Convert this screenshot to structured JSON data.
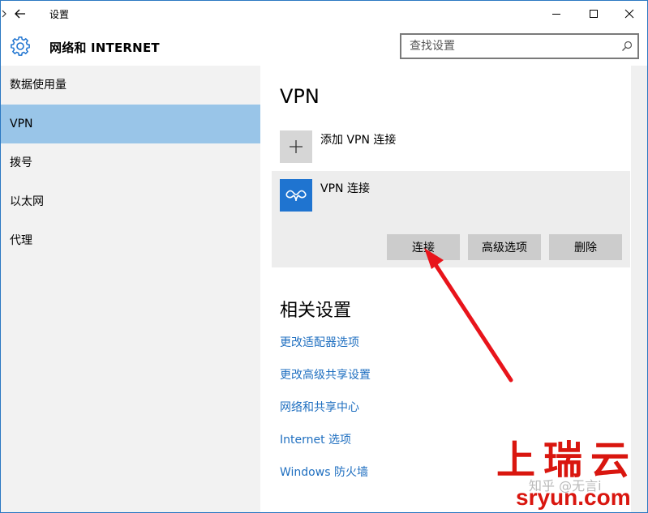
{
  "window": {
    "title": "设置"
  },
  "header": {
    "title": "网络和 INTERNET",
    "search_placeholder": "查找设置"
  },
  "sidebar": {
    "items": [
      {
        "label": "数据使用量",
        "active": false
      },
      {
        "label": "VPN",
        "active": true
      },
      {
        "label": "拨号",
        "active": false
      },
      {
        "label": "以太网",
        "active": false
      },
      {
        "label": "代理",
        "active": false
      }
    ]
  },
  "main": {
    "vpn_title": "VPN",
    "add_vpn_label": "添加 VPN 连接",
    "vpn_connection": {
      "name": "VPN 连接",
      "connect_label": "连接",
      "advanced_label": "高级选项",
      "delete_label": "删除"
    },
    "related_title": "相关设置",
    "related_links": [
      "更改适配器选项",
      "更改高级共享设置",
      "网络和共享中心",
      "Internet 选项",
      "Windows 防火墙"
    ]
  },
  "watermark": {
    "brand": "上瑞云",
    "zhihu": "知乎 @无言i",
    "site": "sryun.com"
  },
  "colors": {
    "accent": "#1f74d0",
    "sidebar_selected": "#99c5e8",
    "link": "#1f6fc0",
    "annotation_arrow": "#e8141b",
    "watermark_red": "#d9160f"
  },
  "icons": {
    "back": "back-arrow-icon",
    "minimize": "minimize-icon",
    "maximize": "maximize-icon",
    "close": "close-icon",
    "settings": "gear-icon",
    "search": "search-icon",
    "add": "plus-icon",
    "vpn": "vpn-link-icon"
  }
}
